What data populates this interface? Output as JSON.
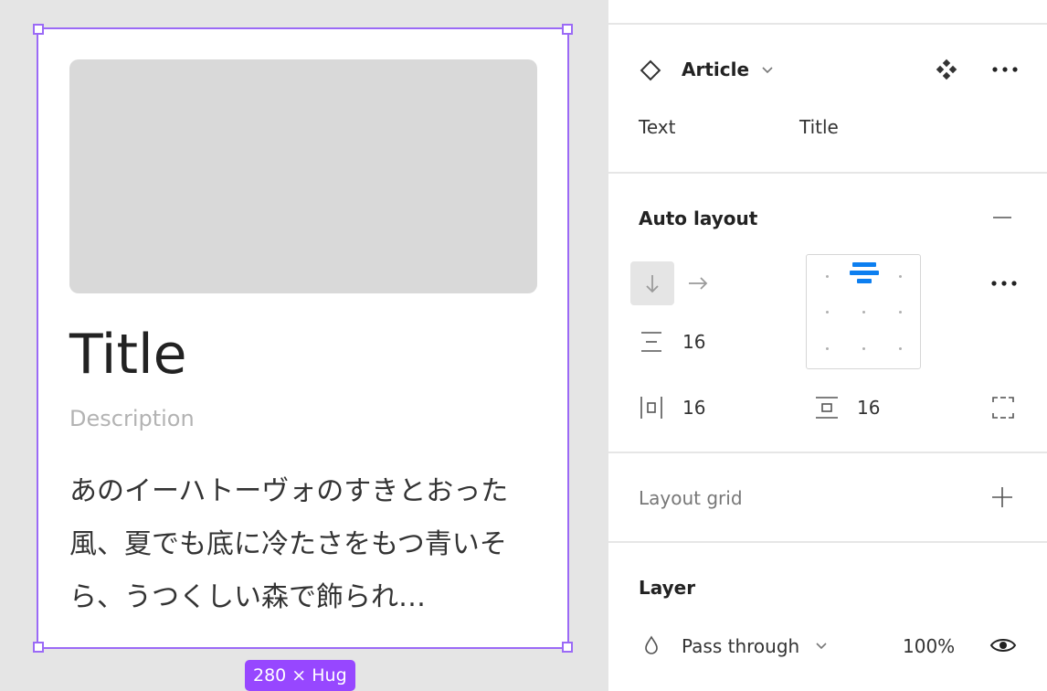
{
  "canvas": {
    "card": {
      "title": "Title",
      "description": "Description",
      "body": "あのイーハトーヴォのすきとおった風、夏でも底に冷たさをもつ青いそら、うつくしい森で飾られ…"
    },
    "size_badge": "280 × Hug"
  },
  "panel": {
    "component": {
      "name": "Article",
      "prop_label": "Text",
      "prop_value": "Title"
    },
    "auto_layout": {
      "heading": "Auto layout",
      "gap": "16",
      "padding_horizontal": "16",
      "padding_vertical": "16",
      "direction": "vertical"
    },
    "layout_grid": {
      "heading": "Layout grid"
    },
    "layer": {
      "heading": "Layer",
      "blend_mode": "Pass through",
      "opacity": "100%"
    }
  },
  "colors": {
    "selection": "#9b6af6",
    "badge": "#9747ff",
    "accent": "#0d7ff0"
  },
  "icons": [
    "component-diamond-icon",
    "chevron-down-icon",
    "component-set-icon",
    "more-icon",
    "minus-icon",
    "arrow-down-icon",
    "arrow-right-icon",
    "vertical-gap-icon",
    "horizontal-padding-icon",
    "vertical-padding-icon",
    "individual-padding-icon",
    "plus-icon",
    "blend-drop-icon",
    "eye-icon"
  ]
}
